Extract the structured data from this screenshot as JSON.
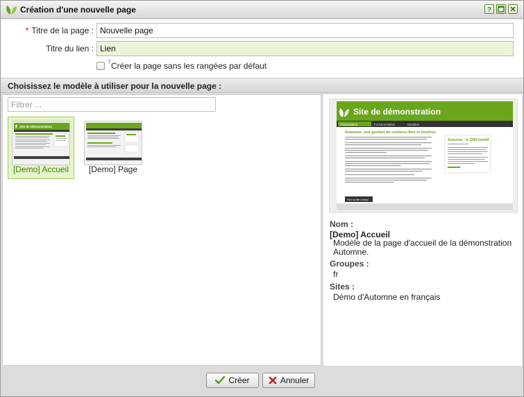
{
  "window": {
    "title": "Création d'une nouvelle page",
    "accent": "#6aa51c"
  },
  "form": {
    "title_label": "Titre de la page :",
    "title_required": "*",
    "title_value": "Nouvelle page",
    "link_label": "Titre du lien :",
    "link_value": "Lien",
    "no_rows_help": "?",
    "no_rows_label": "Créer la page sans les rangées par défaut",
    "no_rows_checked": false
  },
  "templates": {
    "section_title": "Choisissez le modèle à utiliser pour la nouvelle page :",
    "filter_placeholder": "Filtrer ...",
    "items": [
      {
        "label": "[Demo] Accueil",
        "selected": true
      },
      {
        "label": "[Demo] Page",
        "selected": false
      }
    ]
  },
  "preview": {
    "site_title": "Site de démonstration",
    "nav": [
      "Présentation",
      "Fonctionnalités",
      "Modules"
    ],
    "heading": "Automne, une gestion de contenu libre et intuitive",
    "side_title": "Automne : le CMS intuitif",
    "footer_links": [
      "Plan du site",
      "Contact"
    ]
  },
  "details": {
    "name_label": "Nom :",
    "name_value": "[Demo] Accueil",
    "description": "Modèle de la page d'accueil de la démonstration Automne.",
    "groups_label": "Groupes :",
    "groups_value": "fr",
    "sites_label": "Sites :",
    "sites_value": "Démo d'Automne en français"
  },
  "footer": {
    "create_label": "Créer",
    "cancel_label": "Annuler"
  }
}
